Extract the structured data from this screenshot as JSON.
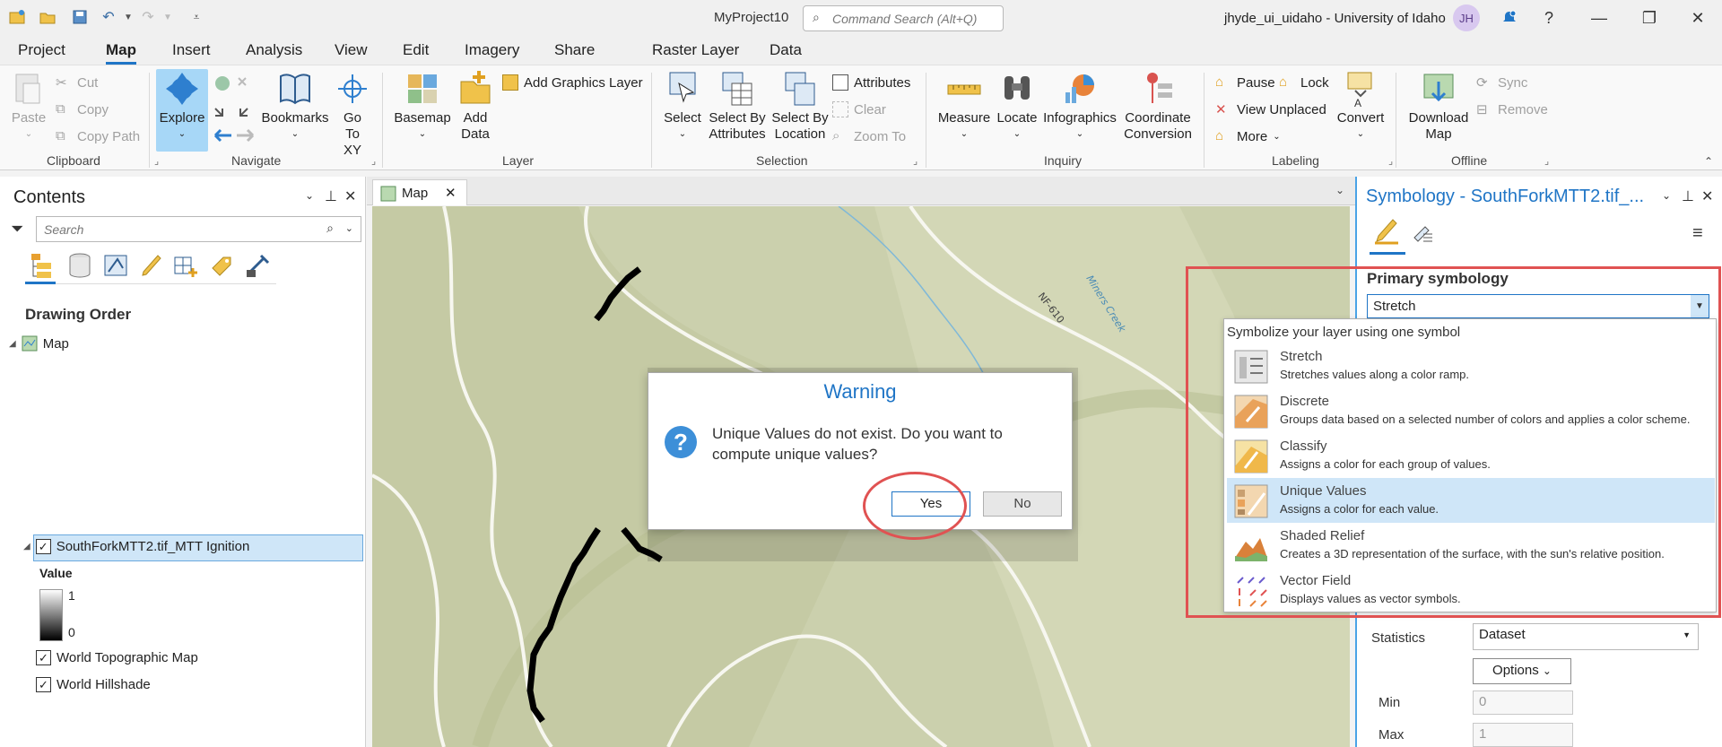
{
  "titlebar": {
    "project_name": "MyProject10",
    "command_search_placeholder": "Command Search (Alt+Q)",
    "user": "jhyde_ui_uidaho - University of Idaho",
    "avatar_initials": "JH"
  },
  "menu_tabs": [
    "Project",
    "Map",
    "Insert",
    "Analysis",
    "View",
    "Edit",
    "Imagery",
    "Share",
    "Raster Layer",
    "Data"
  ],
  "active_tab": "Map",
  "ribbon": {
    "clipboard": {
      "label": "Clipboard",
      "paste": "Paste",
      "cut": "Cut",
      "copy": "Copy",
      "copy_path": "Copy Path"
    },
    "navigate": {
      "label": "Navigate",
      "explore": "Explore",
      "bookmarks": "Bookmarks",
      "go_to_xy_1": "Go",
      "go_to_xy_2": "To XY"
    },
    "layer": {
      "label": "Layer",
      "basemap": "Basemap",
      "add_data_1": "Add",
      "add_data_2": "Data",
      "add_graphics_layer": "Add Graphics Layer"
    },
    "selection": {
      "label": "Selection",
      "select": "Select",
      "select_by_attributes_1": "Select By",
      "select_by_attributes_2": "Attributes",
      "select_by_location_1": "Select By",
      "select_by_location_2": "Location",
      "attributes": "Attributes",
      "clear": "Clear",
      "zoom_to": "Zoom To"
    },
    "inquiry": {
      "label": "Inquiry",
      "measure": "Measure",
      "locate": "Locate",
      "infographics": "Infographics",
      "coordinate_conversion_1": "Coordinate",
      "coordinate_conversion_2": "Conversion"
    },
    "labeling": {
      "label": "Labeling",
      "pause": "Pause",
      "lock": "Lock",
      "view_unplaced": "View Unplaced",
      "more": "More",
      "convert": "Convert"
    },
    "offline": {
      "label": "Offline",
      "download_map_1": "Download",
      "download_map_2": "Map",
      "sync": "Sync",
      "remove": "Remove"
    }
  },
  "contents": {
    "title": "Contents",
    "search_placeholder": "Search",
    "drawing_order": "Drawing Order",
    "map_label": "Map",
    "layers": [
      {
        "name": "SouthForkMTT2.tif_MTT Ignition",
        "checked": true
      },
      {
        "name": "World Topographic Map",
        "checked": true
      },
      {
        "name": "World Hillshade",
        "checked": true
      }
    ],
    "legend": {
      "title": "Value",
      "high": "1",
      "low": "0"
    }
  },
  "map_tab": {
    "label": "Map"
  },
  "map_labels": {
    "road": "NF-610",
    "creek": "Miners Creek"
  },
  "warning_dialog": {
    "title": "Warning",
    "message": "Unique Values do not exist. Do you want to compute unique values?",
    "yes": "Yes",
    "no": "No"
  },
  "symbology": {
    "title": "Symbology - SouthForkMTT2.tif_...",
    "primary_label": "Primary symbology",
    "primary_value": "Stretch",
    "dropdown_header": "Symbolize your layer using one symbol",
    "options": [
      {
        "name": "Stretch",
        "desc": "Stretches values along a color ramp.",
        "selected": false
      },
      {
        "name": "Discrete",
        "desc": "Groups data based on a selected number of colors and applies a color scheme.",
        "selected": false
      },
      {
        "name": "Classify",
        "desc": "Assigns a color for each group of values.",
        "selected": false
      },
      {
        "name": "Unique Values",
        "desc": "Assigns a color for each value.",
        "selected": true
      },
      {
        "name": "Shaded Relief",
        "desc": "Creates a 3D representation of the surface, with the sun's relative position.",
        "selected": false
      },
      {
        "name": "Vector Field",
        "desc": "Displays values as vector symbols.",
        "selected": false
      }
    ],
    "statistics_label": "Statistics",
    "statistics_value": "Dataset",
    "options_button": "Options",
    "min_label": "Min",
    "min_value": "0",
    "max_label": "Max",
    "max_value": "1"
  },
  "colors": {
    "accent": "#1f75c6",
    "highlight": "#cfe6f8",
    "annotation": "#e05252"
  }
}
